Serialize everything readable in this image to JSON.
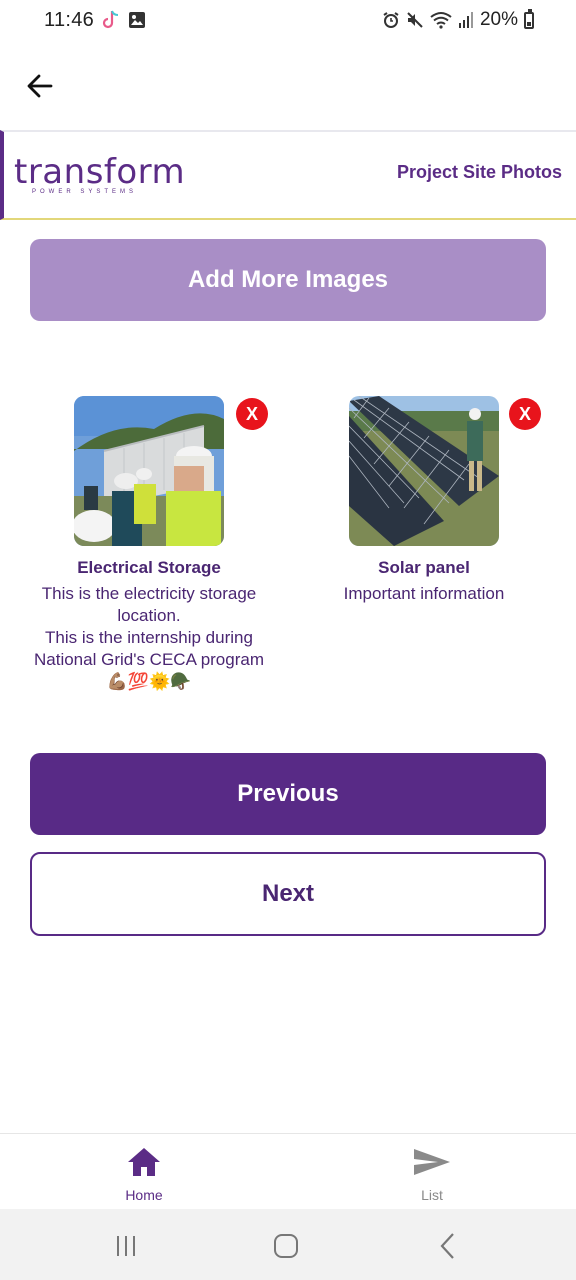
{
  "status_bar": {
    "time": "11:46",
    "battery_text": "20%"
  },
  "app_bar": {
    "back_icon": "arrow-left-icon"
  },
  "header": {
    "logo_text": "transform",
    "logo_subtext": "POWER SYSTEMS",
    "title": "Project Site Photos"
  },
  "actions": {
    "add_more_label": "Add More Images",
    "previous_label": "Previous",
    "next_label": "Next"
  },
  "photos": [
    {
      "title": "Electrical Storage",
      "description": "This is the electricity storage location.\nThis is the internship during National Grid's CECA program💪🏽💯🌞🪖",
      "remove_label": "X"
    },
    {
      "title": "Solar panel",
      "description": "Important information",
      "remove_label": "X"
    }
  ],
  "bottom_nav": {
    "items": [
      {
        "label": "Home",
        "icon": "home-icon",
        "active": true
      },
      {
        "label": "List",
        "icon": "send-icon",
        "active": false
      }
    ]
  },
  "colors": {
    "brand_purple": "#582a86",
    "light_purple": "#a98ec6",
    "remove_red": "#e8141c",
    "header_underline": "#e2d77a"
  }
}
